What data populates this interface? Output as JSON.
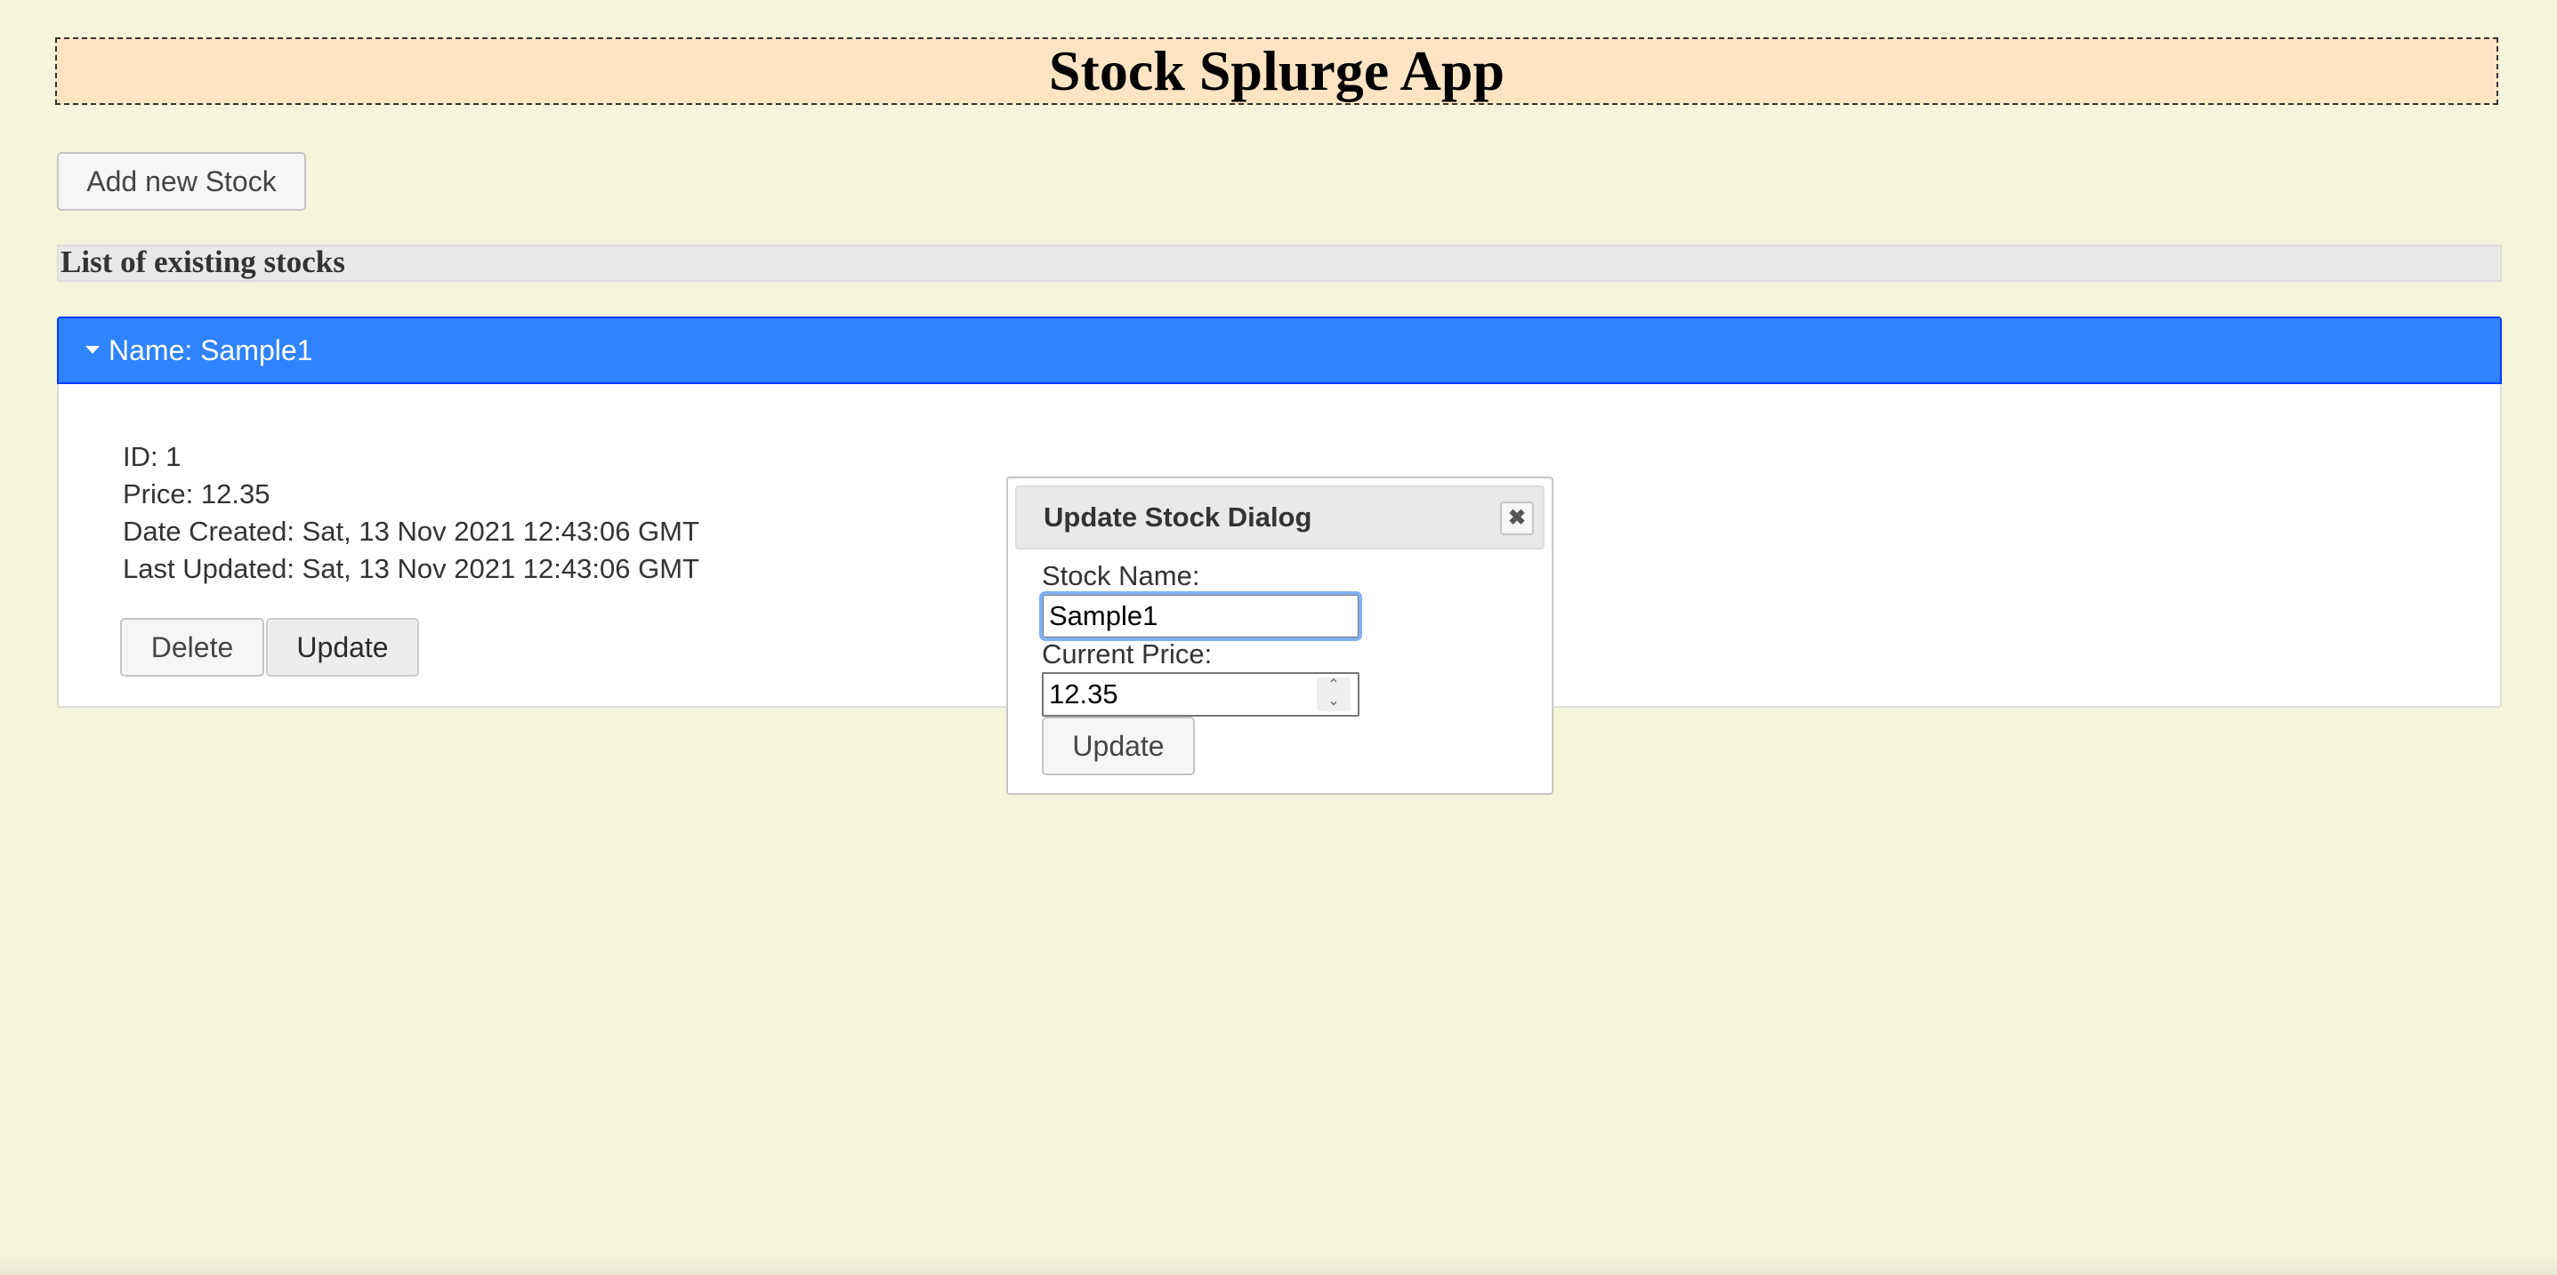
{
  "header": {
    "title": "Stock Splurge App"
  },
  "toolbar": {
    "add_label": "Add new Stock"
  },
  "list": {
    "heading": "List of existing stocks"
  },
  "stock": {
    "header_label": "Name: Sample1",
    "id_line": "ID: 1",
    "price_line": "Price: 12.35",
    "created_line": "Date Created: Sat, 13 Nov 2021 12:43:06 GMT",
    "updated_line": "Last Updated: Sat, 13 Nov 2021 12:43:06 GMT",
    "delete_label": "Delete",
    "update_label": "Update"
  },
  "dialog": {
    "title": "Update Stock Dialog",
    "close_icon": "close-icon",
    "name_label": "Stock Name:",
    "name_value": "Sample1",
    "price_label": "Current Price:",
    "price_value": "12.35",
    "update_label": "Update"
  },
  "colors": {
    "background": "#f5f5dc",
    "header_bg": "#ffe4c4",
    "accent": "#3083ff"
  }
}
